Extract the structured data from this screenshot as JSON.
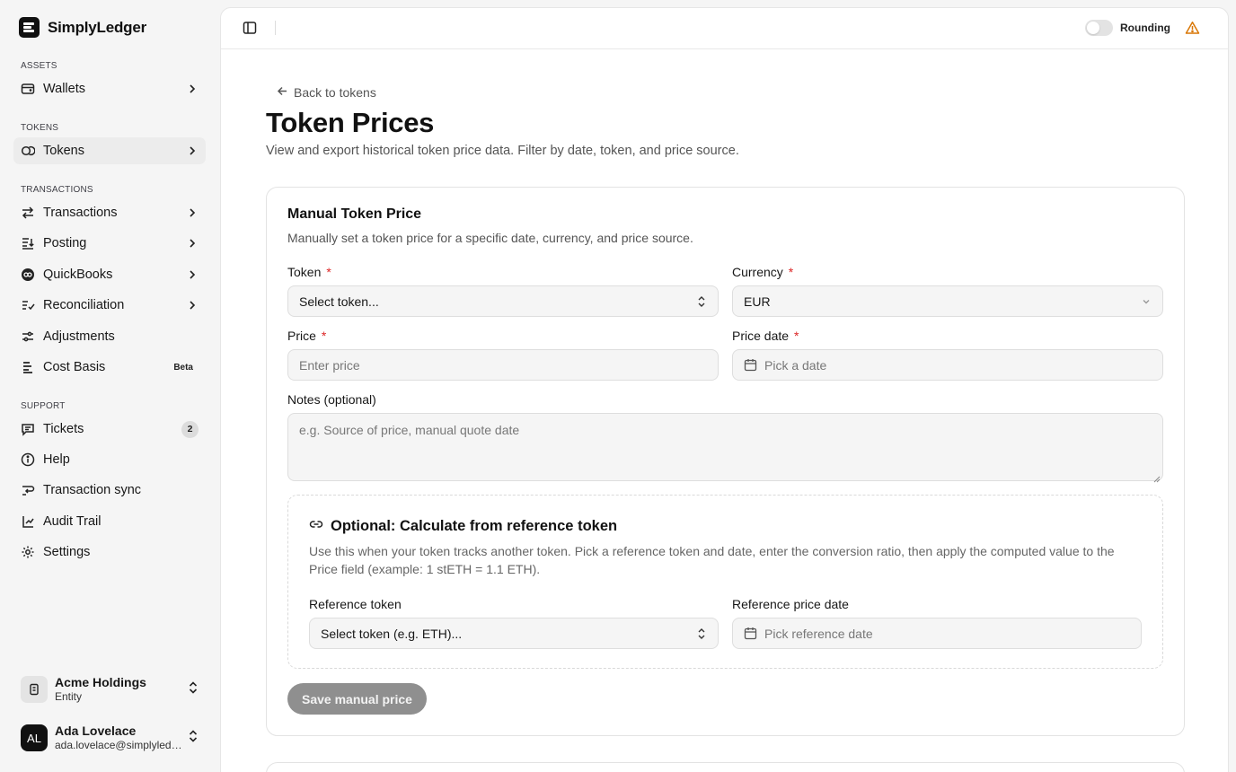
{
  "brand": {
    "name": "SimplyLedger"
  },
  "sidebar": {
    "sections": {
      "assets": "ASSETS",
      "tokens": "TOKENS",
      "transactions": "TRANSACTIONS",
      "support": "SUPPORT"
    },
    "items": {
      "wallets": "Wallets",
      "tokens": "Tokens",
      "transactions": "Transactions",
      "posting": "Posting",
      "quickbooks": "QuickBooks",
      "reconciliation": "Reconciliation",
      "adjustments": "Adjustments",
      "cost_basis": "Cost Basis",
      "cost_basis_badge": "Beta",
      "tickets": "Tickets",
      "tickets_count": "2",
      "help": "Help",
      "transaction_sync": "Transaction sync",
      "audit_trail": "Audit Trail",
      "settings": "Settings"
    },
    "entity": {
      "name": "Acme Holdings",
      "sub": "Entity"
    },
    "user": {
      "initials": "AL",
      "name": "Ada Lovelace",
      "email": "ada.lovelace@simplyledger.com"
    }
  },
  "topbar": {
    "rounding_label": "Rounding",
    "rounding_on": false
  },
  "page": {
    "back_link": "Back to tokens",
    "title": "Token Prices",
    "description": "View and export historical token price data. Filter by date, token, and price source."
  },
  "form": {
    "title": "Manual Token Price",
    "description": "Manually set a token price for a specific date, currency, and price source.",
    "token": {
      "label": "Token",
      "required": "*",
      "placeholder": "Select token..."
    },
    "currency": {
      "label": "Currency",
      "required": "*",
      "value": "EUR"
    },
    "price": {
      "label": "Price",
      "required": "*",
      "placeholder": "Enter price"
    },
    "price_date": {
      "label": "Price date",
      "required": "*",
      "placeholder": "Pick a date"
    },
    "notes": {
      "label": "Notes (optional)",
      "placeholder": "e.g. Source of price, manual quote date"
    },
    "reference": {
      "title": "Optional: Calculate from reference token",
      "description": "Use this when your token tracks another token. Pick a reference token and date, enter the conversion ratio, then apply the computed value to the Price field (example: 1 stETH = 1.1 ETH).",
      "token_label": "Reference token",
      "token_placeholder": "Select token (e.g. ETH)...",
      "date_label": "Reference price date",
      "date_placeholder": "Pick reference date"
    },
    "save_label": "Save manual price"
  },
  "colors": {
    "required": "#dc2626",
    "warning": "#d97706",
    "disabled_button": "#8f8f8f"
  }
}
